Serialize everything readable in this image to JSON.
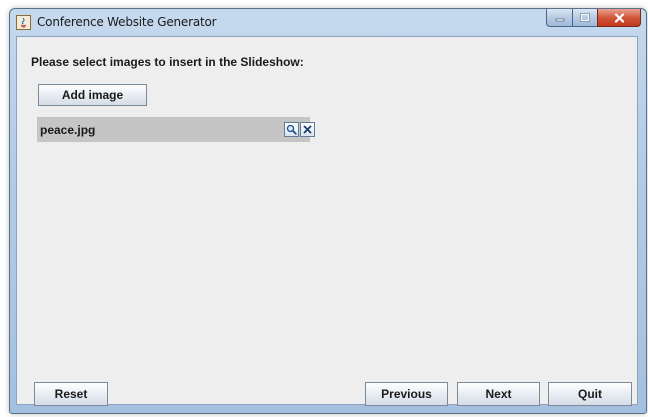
{
  "window": {
    "title": "Conference Website Generator",
    "icons": {
      "app": "java-icon",
      "minimize": "minimize-icon",
      "maximize": "maximize-icon",
      "close": "close-icon"
    }
  },
  "content": {
    "prompt": "Please select images to insert in the Slideshow:",
    "add_image_label": "Add image",
    "files": [
      {
        "name": "peace.jpg",
        "view_icon": "magnifier-icon",
        "remove_icon": "remove-x-icon"
      }
    ]
  },
  "footer": {
    "reset_label": "Reset",
    "previous_label": "Previous",
    "next_label": "Next",
    "quit_label": "Quit"
  },
  "colors": {
    "frame": "#b3cbe6",
    "client_background": "#eeeeee",
    "file_row_background": "#c5c5c5",
    "close_button": "#d2573c"
  }
}
